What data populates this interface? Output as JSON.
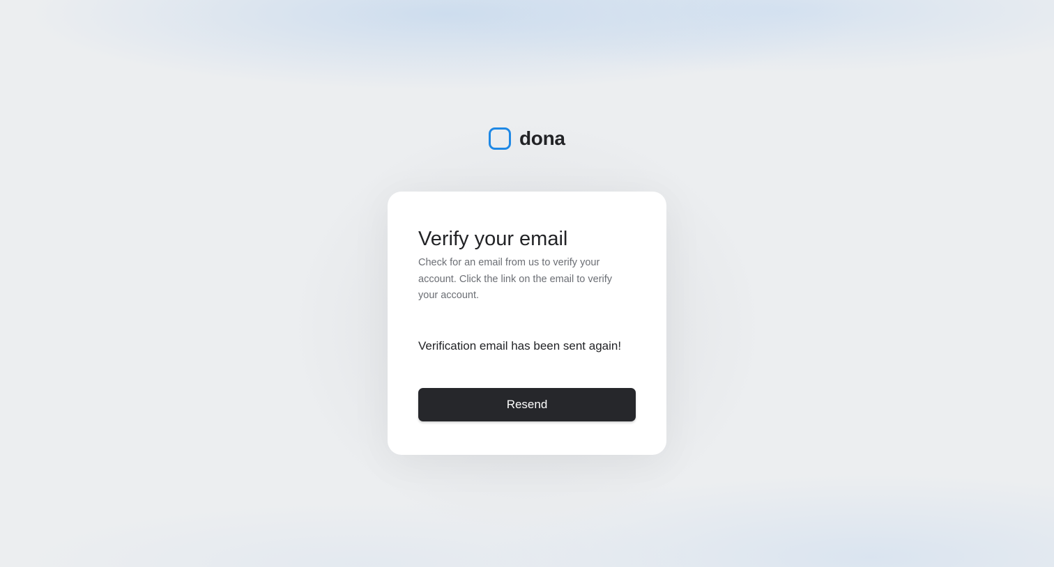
{
  "brand": {
    "name": "dona",
    "logo_icon": "rounded-square-icon",
    "accent_color": "#1e88e5"
  },
  "card": {
    "title": "Verify your email",
    "description": "Check for an email from us to verify your account. Click the link on the email to verify your account.",
    "status_message": "Verification email has been sent again!",
    "resend_label": "Resend",
    "button_color": "#26272b"
  }
}
